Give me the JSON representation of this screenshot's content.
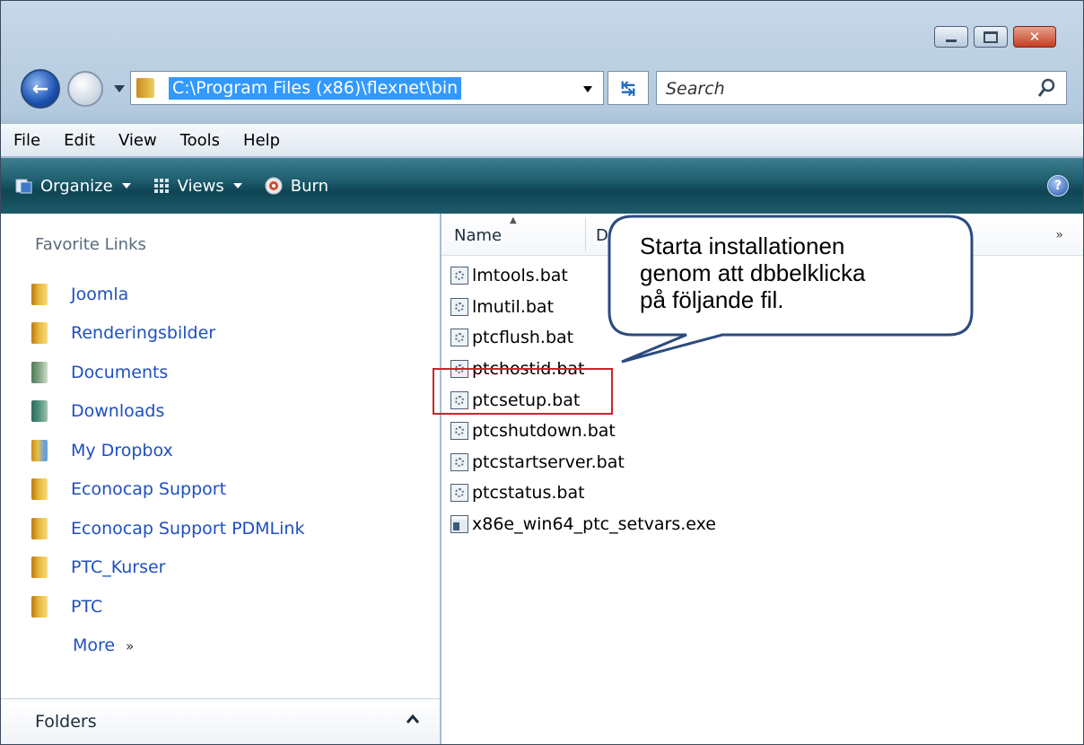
{
  "window": {
    "caption": {
      "minimize": "minimize",
      "maximize": "maximize",
      "close": "✕"
    }
  },
  "address_bar": {
    "path": "C:\\Program Files (x86)\\flexnet\\bin",
    "search_placeholder": "Search"
  },
  "menu": [
    "File",
    "Edit",
    "View",
    "Tools",
    "Help"
  ],
  "command_bar": {
    "organize": "Organize",
    "views": "Views",
    "burn": "Burn",
    "help": "?"
  },
  "nav": {
    "favorites_title": "Favorite Links",
    "favorites": [
      {
        "label": "Joomla",
        "icon": "folder-icon"
      },
      {
        "label": "Renderingsbilder",
        "icon": "folder-icon"
      },
      {
        "label": "Documents",
        "icon": "documents-icon"
      },
      {
        "label": "Downloads",
        "icon": "downloads-icon"
      },
      {
        "label": "My Dropbox",
        "icon": "dropbox-folder-icon"
      },
      {
        "label": "Econocap Support",
        "icon": "folder-icon"
      },
      {
        "label": "Econocap Support PDMLink",
        "icon": "folder-icon"
      },
      {
        "label": "PTC_Kurser",
        "icon": "folder-icon"
      },
      {
        "label": "PTC",
        "icon": "folder-icon"
      }
    ],
    "more": "More",
    "more_arrow": "»",
    "folders": "Folders"
  },
  "file_pane": {
    "columns": {
      "name": "Name",
      "next": "D",
      "more": "»"
    },
    "files": [
      {
        "name": "lmtools.bat",
        "type": "bat"
      },
      {
        "name": "lmutil.bat",
        "type": "bat"
      },
      {
        "name": "ptcflush.bat",
        "type": "bat"
      },
      {
        "name": "ptchostid.bat",
        "type": "bat"
      },
      {
        "name": "ptcsetup.bat",
        "type": "bat"
      },
      {
        "name": "ptcshutdown.bat",
        "type": "bat"
      },
      {
        "name": "ptcstartserver.bat",
        "type": "bat"
      },
      {
        "name": "ptcstatus.bat",
        "type": "bat"
      },
      {
        "name": "x86e_win64_ptc_setvars.exe",
        "type": "exe"
      }
    ],
    "highlighted_file": "ptcsetup.bat"
  },
  "callout": {
    "line1": "Starta installationen",
    "line2": "genom att dbbelklicka",
    "line3": "på följande fil."
  },
  "colors": {
    "link_blue": "#1f4fbf",
    "selection_blue": "#3399ff",
    "command_bar_teal": "#1e5e6e",
    "highlight_red": "#c8272c"
  }
}
